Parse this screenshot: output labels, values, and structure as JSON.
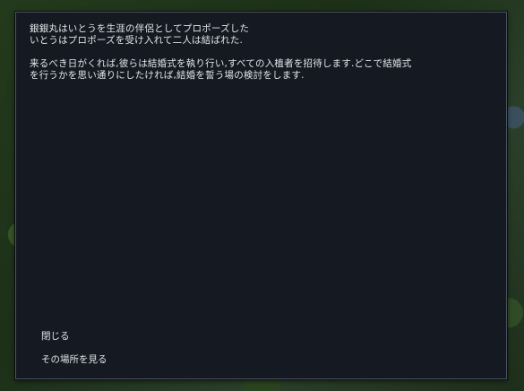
{
  "dialog": {
    "paragraphs": [
      [
        "銀銀丸はいとうを生涯の伴侶としてプロポーズした",
        "いとうはプロポーズを受け入れて二人は結ばれた."
      ],
      [
        "来るべき日がくれば,彼らは結婚式を執り行い,すべての入植者を招待します.どこで結婚式",
        "を行うかを思い通りにしたければ,結婚を誓う場の検討をします."
      ]
    ],
    "options": {
      "close_label": "閉じる",
      "view_location_label": "その場所を見る"
    }
  }
}
